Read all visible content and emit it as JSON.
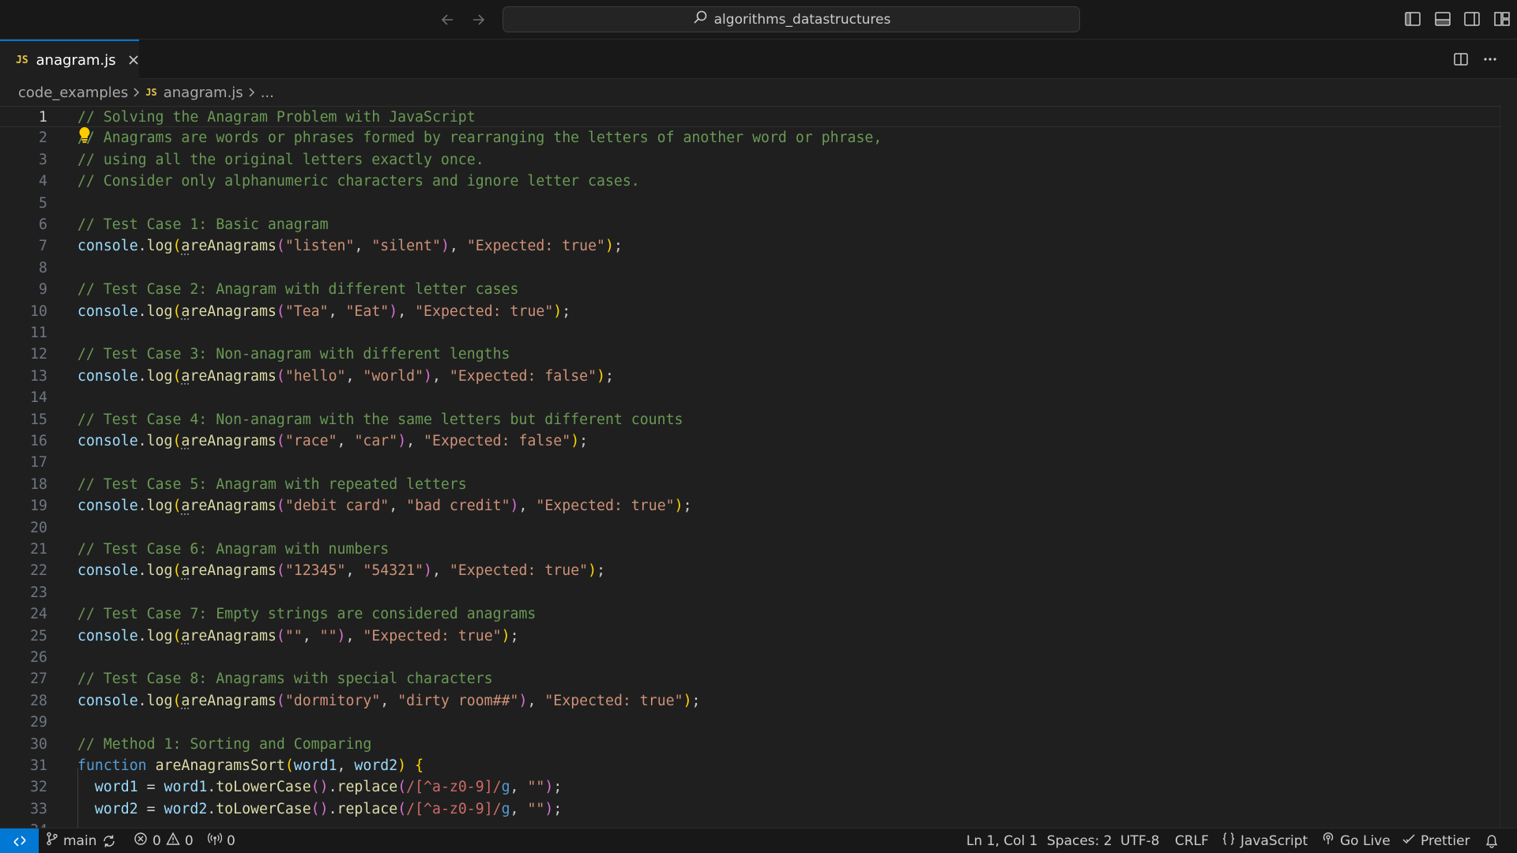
{
  "titlebar": {
    "search_text": "algorithms_datastructures"
  },
  "tabs": [
    {
      "label": "anagram.js",
      "icon": "JS"
    }
  ],
  "breadcrumb": {
    "folder": "code_examples",
    "file_icon": "JS",
    "file": "anagram.js",
    "tail": "..."
  },
  "editor": {
    "lines": [
      {
        "n": "1",
        "tokens": [
          {
            "t": "// Solving the Anagram Problem with JavaScript",
            "c": "comment"
          }
        ]
      },
      {
        "n": "2",
        "tokens": [
          {
            "t": "// Anagrams are words or phrases formed by rearranging the letters of another word or phrase,",
            "c": "comment"
          }
        ]
      },
      {
        "n": "3",
        "tokens": [
          {
            "t": "// using all the original letters exactly once.",
            "c": "comment"
          }
        ]
      },
      {
        "n": "4",
        "tokens": [
          {
            "t": "// Consider only alphanumeric characters and ignore letter cases.",
            "c": "comment"
          }
        ]
      },
      {
        "n": "5",
        "tokens": []
      },
      {
        "n": "6",
        "tokens": [
          {
            "t": "// Test Case 1: Basic anagram",
            "c": "comment"
          }
        ]
      },
      {
        "n": "7",
        "tokens": [
          {
            "t": "console",
            "c": "var"
          },
          {
            "t": ".",
            "c": "punc"
          },
          {
            "t": "log",
            "c": "fn"
          },
          {
            "t": "(",
            "c": "b1"
          },
          {
            "t": "a",
            "c": "fn",
            "hint": true
          },
          {
            "t": "reAnagrams",
            "c": "fn"
          },
          {
            "t": "(",
            "c": "b2"
          },
          {
            "t": "\"listen\"",
            "c": "str"
          },
          {
            "t": ", ",
            "c": "punc"
          },
          {
            "t": "\"silent\"",
            "c": "str"
          },
          {
            "t": ")",
            "c": "b2"
          },
          {
            "t": ", ",
            "c": "punc"
          },
          {
            "t": "\"Expected: true\"",
            "c": "str"
          },
          {
            "t": ")",
            "c": "b1"
          },
          {
            "t": ";",
            "c": "punc"
          }
        ]
      },
      {
        "n": "8",
        "tokens": []
      },
      {
        "n": "9",
        "tokens": [
          {
            "t": "// Test Case 2: Anagram with different letter cases",
            "c": "comment"
          }
        ]
      },
      {
        "n": "10",
        "tokens": [
          {
            "t": "console",
            "c": "var"
          },
          {
            "t": ".",
            "c": "punc"
          },
          {
            "t": "log",
            "c": "fn"
          },
          {
            "t": "(",
            "c": "b1"
          },
          {
            "t": "a",
            "c": "fn",
            "hint": true
          },
          {
            "t": "reAnagrams",
            "c": "fn"
          },
          {
            "t": "(",
            "c": "b2"
          },
          {
            "t": "\"Tea\"",
            "c": "str"
          },
          {
            "t": ", ",
            "c": "punc"
          },
          {
            "t": "\"Eat\"",
            "c": "str"
          },
          {
            "t": ")",
            "c": "b2"
          },
          {
            "t": ", ",
            "c": "punc"
          },
          {
            "t": "\"Expected: true\"",
            "c": "str"
          },
          {
            "t": ")",
            "c": "b1"
          },
          {
            "t": ";",
            "c": "punc"
          }
        ]
      },
      {
        "n": "11",
        "tokens": []
      },
      {
        "n": "12",
        "tokens": [
          {
            "t": "// Test Case 3: Non-anagram with different lengths",
            "c": "comment"
          }
        ]
      },
      {
        "n": "13",
        "tokens": [
          {
            "t": "console",
            "c": "var"
          },
          {
            "t": ".",
            "c": "punc"
          },
          {
            "t": "log",
            "c": "fn"
          },
          {
            "t": "(",
            "c": "b1"
          },
          {
            "t": "a",
            "c": "fn",
            "hint": true
          },
          {
            "t": "reAnagrams",
            "c": "fn"
          },
          {
            "t": "(",
            "c": "b2"
          },
          {
            "t": "\"hello\"",
            "c": "str"
          },
          {
            "t": ", ",
            "c": "punc"
          },
          {
            "t": "\"world\"",
            "c": "str"
          },
          {
            "t": ")",
            "c": "b2"
          },
          {
            "t": ", ",
            "c": "punc"
          },
          {
            "t": "\"Expected: false\"",
            "c": "str"
          },
          {
            "t": ")",
            "c": "b1"
          },
          {
            "t": ";",
            "c": "punc"
          }
        ]
      },
      {
        "n": "14",
        "tokens": []
      },
      {
        "n": "15",
        "tokens": [
          {
            "t": "// Test Case 4: Non-anagram with the same letters but different counts",
            "c": "comment"
          }
        ]
      },
      {
        "n": "16",
        "tokens": [
          {
            "t": "console",
            "c": "var"
          },
          {
            "t": ".",
            "c": "punc"
          },
          {
            "t": "log",
            "c": "fn"
          },
          {
            "t": "(",
            "c": "b1"
          },
          {
            "t": "a",
            "c": "fn",
            "hint": true
          },
          {
            "t": "reAnagrams",
            "c": "fn"
          },
          {
            "t": "(",
            "c": "b2"
          },
          {
            "t": "\"race\"",
            "c": "str"
          },
          {
            "t": ", ",
            "c": "punc"
          },
          {
            "t": "\"car\"",
            "c": "str"
          },
          {
            "t": ")",
            "c": "b2"
          },
          {
            "t": ", ",
            "c": "punc"
          },
          {
            "t": "\"Expected: false\"",
            "c": "str"
          },
          {
            "t": ")",
            "c": "b1"
          },
          {
            "t": ";",
            "c": "punc"
          }
        ]
      },
      {
        "n": "17",
        "tokens": []
      },
      {
        "n": "18",
        "tokens": [
          {
            "t": "// Test Case 5: Anagram with repeated letters",
            "c": "comment"
          }
        ]
      },
      {
        "n": "19",
        "tokens": [
          {
            "t": "console",
            "c": "var"
          },
          {
            "t": ".",
            "c": "punc"
          },
          {
            "t": "log",
            "c": "fn"
          },
          {
            "t": "(",
            "c": "b1"
          },
          {
            "t": "a",
            "c": "fn",
            "hint": true
          },
          {
            "t": "reAnagrams",
            "c": "fn"
          },
          {
            "t": "(",
            "c": "b2"
          },
          {
            "t": "\"debit card\"",
            "c": "str"
          },
          {
            "t": ", ",
            "c": "punc"
          },
          {
            "t": "\"bad credit\"",
            "c": "str"
          },
          {
            "t": ")",
            "c": "b2"
          },
          {
            "t": ", ",
            "c": "punc"
          },
          {
            "t": "\"Expected: true\"",
            "c": "str"
          },
          {
            "t": ")",
            "c": "b1"
          },
          {
            "t": ";",
            "c": "punc"
          }
        ]
      },
      {
        "n": "20",
        "tokens": []
      },
      {
        "n": "21",
        "tokens": [
          {
            "t": "// Test Case 6: Anagram with numbers",
            "c": "comment"
          }
        ]
      },
      {
        "n": "22",
        "tokens": [
          {
            "t": "console",
            "c": "var"
          },
          {
            "t": ".",
            "c": "punc"
          },
          {
            "t": "log",
            "c": "fn"
          },
          {
            "t": "(",
            "c": "b1"
          },
          {
            "t": "a",
            "c": "fn",
            "hint": true
          },
          {
            "t": "reAnagrams",
            "c": "fn"
          },
          {
            "t": "(",
            "c": "b2"
          },
          {
            "t": "\"12345\"",
            "c": "str"
          },
          {
            "t": ", ",
            "c": "punc"
          },
          {
            "t": "\"54321\"",
            "c": "str"
          },
          {
            "t": ")",
            "c": "b2"
          },
          {
            "t": ", ",
            "c": "punc"
          },
          {
            "t": "\"Expected: true\"",
            "c": "str"
          },
          {
            "t": ")",
            "c": "b1"
          },
          {
            "t": ";",
            "c": "punc"
          }
        ]
      },
      {
        "n": "23",
        "tokens": []
      },
      {
        "n": "24",
        "tokens": [
          {
            "t": "// Test Case 7: Empty strings are considered anagrams",
            "c": "comment"
          }
        ]
      },
      {
        "n": "25",
        "tokens": [
          {
            "t": "console",
            "c": "var"
          },
          {
            "t": ".",
            "c": "punc"
          },
          {
            "t": "log",
            "c": "fn"
          },
          {
            "t": "(",
            "c": "b1"
          },
          {
            "t": "a",
            "c": "fn",
            "hint": true
          },
          {
            "t": "reAnagrams",
            "c": "fn"
          },
          {
            "t": "(",
            "c": "b2"
          },
          {
            "t": "\"\"",
            "c": "str"
          },
          {
            "t": ", ",
            "c": "punc"
          },
          {
            "t": "\"\"",
            "c": "str"
          },
          {
            "t": ")",
            "c": "b2"
          },
          {
            "t": ", ",
            "c": "punc"
          },
          {
            "t": "\"Expected: true\"",
            "c": "str"
          },
          {
            "t": ")",
            "c": "b1"
          },
          {
            "t": ";",
            "c": "punc"
          }
        ]
      },
      {
        "n": "26",
        "tokens": []
      },
      {
        "n": "27",
        "tokens": [
          {
            "t": "// Test Case 8: Anagrams with special characters",
            "c": "comment"
          }
        ]
      },
      {
        "n": "28",
        "tokens": [
          {
            "t": "console",
            "c": "var"
          },
          {
            "t": ".",
            "c": "punc"
          },
          {
            "t": "log",
            "c": "fn"
          },
          {
            "t": "(",
            "c": "b1"
          },
          {
            "t": "a",
            "c": "fn",
            "hint": true
          },
          {
            "t": "reAnagrams",
            "c": "fn"
          },
          {
            "t": "(",
            "c": "b2"
          },
          {
            "t": "\"dormitory\"",
            "c": "str"
          },
          {
            "t": ", ",
            "c": "punc"
          },
          {
            "t": "\"dirty room##\"",
            "c": "str"
          },
          {
            "t": ")",
            "c": "b2"
          },
          {
            "t": ", ",
            "c": "punc"
          },
          {
            "t": "\"Expected: true\"",
            "c": "str"
          },
          {
            "t": ")",
            "c": "b1"
          },
          {
            "t": ";",
            "c": "punc"
          }
        ]
      },
      {
        "n": "29",
        "tokens": []
      },
      {
        "n": "30",
        "tokens": [
          {
            "t": "// Method 1: Sorting and Comparing",
            "c": "comment"
          }
        ]
      },
      {
        "n": "31",
        "tokens": [
          {
            "t": "function",
            "c": "kw"
          },
          {
            "t": " ",
            "c": "punc"
          },
          {
            "t": "areAnagramsSort",
            "c": "fn"
          },
          {
            "t": "(",
            "c": "b1"
          },
          {
            "t": "word1",
            "c": "var"
          },
          {
            "t": ", ",
            "c": "punc"
          },
          {
            "t": "word2",
            "c": "var"
          },
          {
            "t": ")",
            "c": "b1"
          },
          {
            "t": " ",
            "c": "punc"
          },
          {
            "t": "{",
            "c": "b1"
          }
        ]
      },
      {
        "n": "32",
        "tokens": [
          {
            "t": "  ",
            "c": "punc"
          },
          {
            "t": "word1",
            "c": "var"
          },
          {
            "t": " = ",
            "c": "punc"
          },
          {
            "t": "word1",
            "c": "var"
          },
          {
            "t": ".",
            "c": "punc"
          },
          {
            "t": "toLowerCase",
            "c": "fn"
          },
          {
            "t": "()",
            "c": "b2"
          },
          {
            "t": ".",
            "c": "punc"
          },
          {
            "t": "replace",
            "c": "fn"
          },
          {
            "t": "(",
            "c": "b2"
          },
          {
            "t": "/[^a-z0-9]/",
            "c": "regex"
          },
          {
            "t": "g",
            "c": "kw"
          },
          {
            "t": ", ",
            "c": "punc"
          },
          {
            "t": "\"\"",
            "c": "str"
          },
          {
            "t": ")",
            "c": "b2"
          },
          {
            "t": ";",
            "c": "punc"
          }
        ]
      },
      {
        "n": "33",
        "tokens": [
          {
            "t": "  ",
            "c": "punc"
          },
          {
            "t": "word2",
            "c": "var"
          },
          {
            "t": " = ",
            "c": "punc"
          },
          {
            "t": "word2",
            "c": "var"
          },
          {
            "t": ".",
            "c": "punc"
          },
          {
            "t": "toLowerCase",
            "c": "fn"
          },
          {
            "t": "()",
            "c": "b2"
          },
          {
            "t": ".",
            "c": "punc"
          },
          {
            "t": "replace",
            "c": "fn"
          },
          {
            "t": "(",
            "c": "b2"
          },
          {
            "t": "/[^a-z0-9]/",
            "c": "regex"
          },
          {
            "t": "g",
            "c": "kw"
          },
          {
            "t": ", ",
            "c": "punc"
          },
          {
            "t": "\"\"",
            "c": "str"
          },
          {
            "t": ")",
            "c": "b2"
          },
          {
            "t": ";",
            "c": "punc"
          }
        ]
      },
      {
        "n": "34",
        "tokens": []
      }
    ]
  },
  "statusbar": {
    "branch": "main",
    "errors": "0",
    "warnings": "0",
    "ports": "0",
    "position": "Ln 1, Col 1",
    "spaces": "Spaces: 2",
    "encoding": "UTF-8",
    "eol": "CRLF",
    "language": "JavaScript",
    "golive": "Go Live",
    "prettier": "Prettier"
  },
  "colors": {
    "accent": "#0078d4",
    "background": "#1f1f1f",
    "chrome": "#181818",
    "comment": "#6a9955",
    "string": "#ce9178",
    "function": "#dcdcaa",
    "variable": "#9cdcfe",
    "keyword": "#569cd6"
  },
  "icons": [
    "back-arrow-icon",
    "forward-arrow-icon",
    "search-icon",
    "toggle-primary-sidebar-icon",
    "toggle-panel-icon",
    "toggle-secondary-sidebar-icon",
    "customize-layout-icon",
    "close-icon",
    "split-editor-icon",
    "more-actions-icon",
    "lightbulb-icon",
    "remote-icon",
    "branch-icon",
    "sync-icon",
    "error-icon",
    "warning-icon",
    "ports-icon",
    "braces-icon",
    "broadcast-icon",
    "check-icon",
    "bell-icon"
  ]
}
